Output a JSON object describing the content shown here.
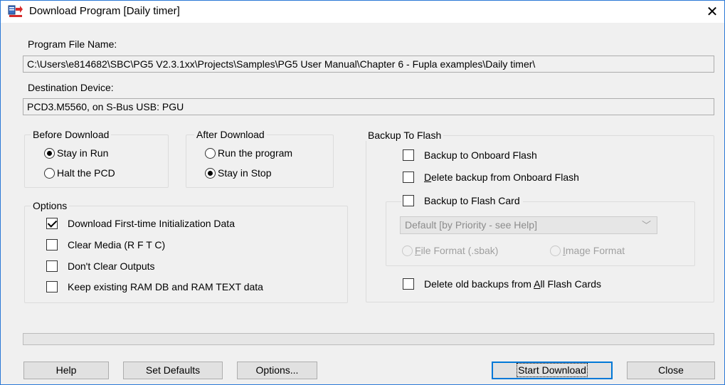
{
  "window": {
    "title": "Download Program [Daily timer]",
    "close_glyph": "✕"
  },
  "program_file": {
    "label": "Program File Name:",
    "value": "C:\\Users\\e814682\\SBC\\PG5 V2.3.1xx\\Projects\\Samples\\PG5 User Manual\\Chapter 6 - Fupla examples\\Daily timer\\"
  },
  "destination": {
    "label": "Destination Device:",
    "value": "PCD3.M5560, on S-Bus USB: PGU"
  },
  "before_download": {
    "title": "Before Download",
    "options": [
      {
        "label": "Stay in Run",
        "checked": true
      },
      {
        "label": "Halt the PCD",
        "checked": false
      }
    ]
  },
  "after_download": {
    "title": "After Download",
    "options": [
      {
        "label": "Run the program",
        "checked": false
      },
      {
        "label": "Stay in Stop",
        "checked": true
      }
    ]
  },
  "options": {
    "title": "Options",
    "items": [
      {
        "label": "Download First-time Initialization Data",
        "checked": true
      },
      {
        "label": "Clear Media (R F T C)",
        "checked": false
      },
      {
        "label": "Don't Clear Outputs",
        "checked": false
      },
      {
        "label": "Keep existing RAM DB and RAM TEXT data",
        "checked": false
      }
    ]
  },
  "backup": {
    "title": "Backup To Flash",
    "onboard": "Backup to Onboard Flash",
    "delete_onboard_pre": "",
    "delete_onboard_u": "D",
    "delete_onboard_post": "elete backup from Onboard Flash",
    "flash_card": "Backup to Flash Card",
    "select_value": "Default [by Priority - see Help]",
    "file_format_u": "F",
    "file_format_post": "ile Format (.sbak)",
    "image_format_u": "I",
    "image_format_post": "mage Format",
    "delete_all_pre": "Delete old backups from ",
    "delete_all_u": "A",
    "delete_all_post": "ll Flash Cards"
  },
  "buttons": {
    "help": "Help",
    "set_defaults": "Set Defaults",
    "options": "Options...",
    "start_download": "Start Download",
    "close": "Close"
  }
}
